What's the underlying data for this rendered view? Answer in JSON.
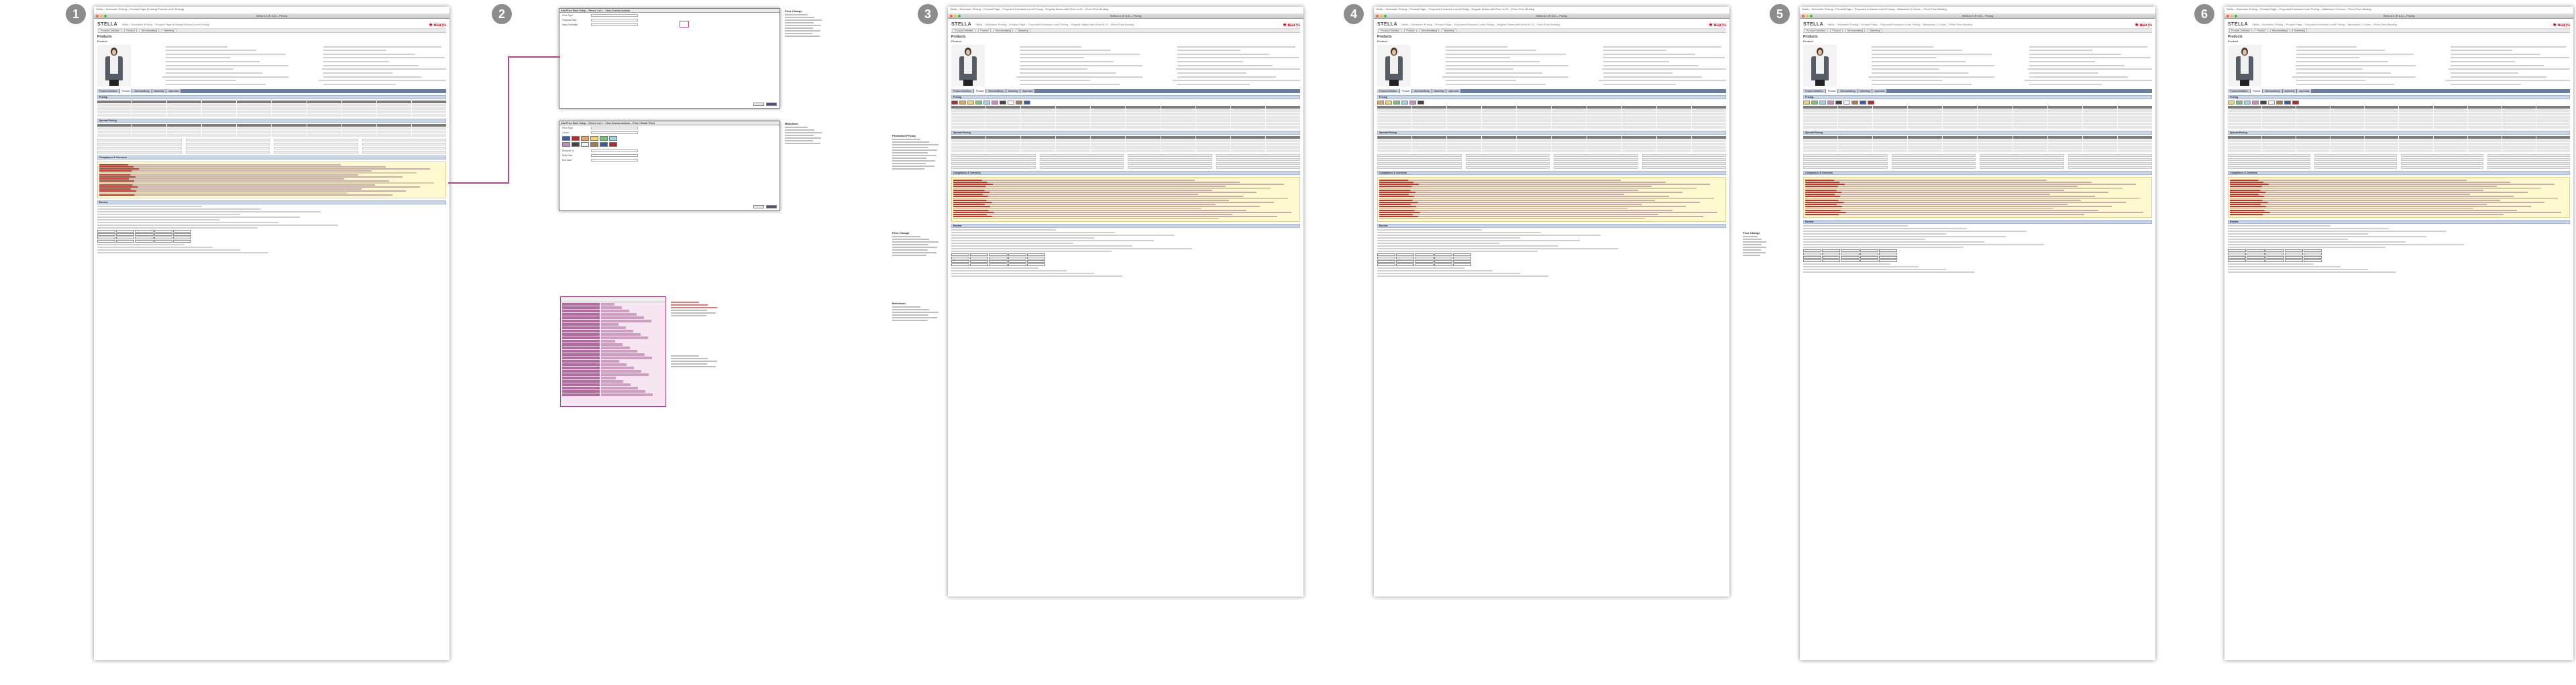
{
  "steps": [
    "1",
    "2",
    "3",
    "4",
    "5",
    "6"
  ],
  "brand": {
    "app_logo": "STELLA",
    "retailer": "macys",
    "star": "★"
  },
  "screens": [
    {
      "caption": "Stella – Scheduler Pricing – Product Page (Existing Product Level Pricing)",
      "window_title": "Stella 6.0 (R 8.6) – Pricing"
    },
    {
      "caption": "Stella – Scheduler Pricing – Product Page – Proposed Exclusive Level Pricing – Regular Status with Price to 20 – Perm Price Binding",
      "window_title": "Stella 6.0 (R 8.6) – Pricing"
    },
    {
      "caption": "Stella – Scheduler Pricing – Product Page – Proposed Exclusive Level Pricing – Regular Status with Price to 20 – Perm Price Binding",
      "window_title": "Stella 6.0 (R 8.6) – Pricing"
    },
    {
      "caption": "Stella – Scheduler Pricing – Product Page – Proposed Exclusive Level Pricing – Markdown 1 Colors – Perm Price Binding",
      "window_title": "Stella 6.0 (R 8.6) – Pricing"
    },
    {
      "caption": "Stella – Scheduler Pricing – Product Page – Proposed Exclusive Level Pricing – Markdown 1 Colors – Perm Price Binding",
      "window_title": "Stella 6.0 (R 8.6) – Pricing"
    }
  ],
  "page": {
    "title": "Products",
    "subtitle": "Product"
  },
  "tabs": [
    "Product Definition",
    "Product",
    "Merchandising",
    "Marketing",
    "Approvals"
  ],
  "section_labels": [
    "Pricing",
    "Special Pricing",
    "Compliance & Overview",
    "Review",
    "Override"
  ],
  "dialogs": [
    {
      "title": "Add Price Each Setup – Prices 1 of 1 – View Custom Actions",
      "rows": [
        "Price Type",
        "Proposal Start",
        "Issue Schedule"
      ]
    },
    {
      "title": "Add Price Each Setup – Prices 1 of 1 – View Custom Actions – Price / Retail / Print",
      "rows": [
        "Price Type",
        "Colors",
        "Discount %",
        "Start Date",
        "End Date"
      ]
    }
  ],
  "annotation_titles": [
    "Price Change",
    "Markdown",
    "Promotion Pricing"
  ],
  "colors": {
    "link": "#b7408a",
    "marker": "#8c8c8c",
    "section_bg": "#c9d6ea",
    "macys_red": "#d4001a",
    "swatch_set": [
      "#3b5aa6",
      "#b82a2a",
      "#e6a35a",
      "#f1d36b",
      "#7cc276",
      "#9ad0e8",
      "#c78ac7",
      "#444444",
      "#f4f4f4",
      "#a77a4f"
    ]
  }
}
